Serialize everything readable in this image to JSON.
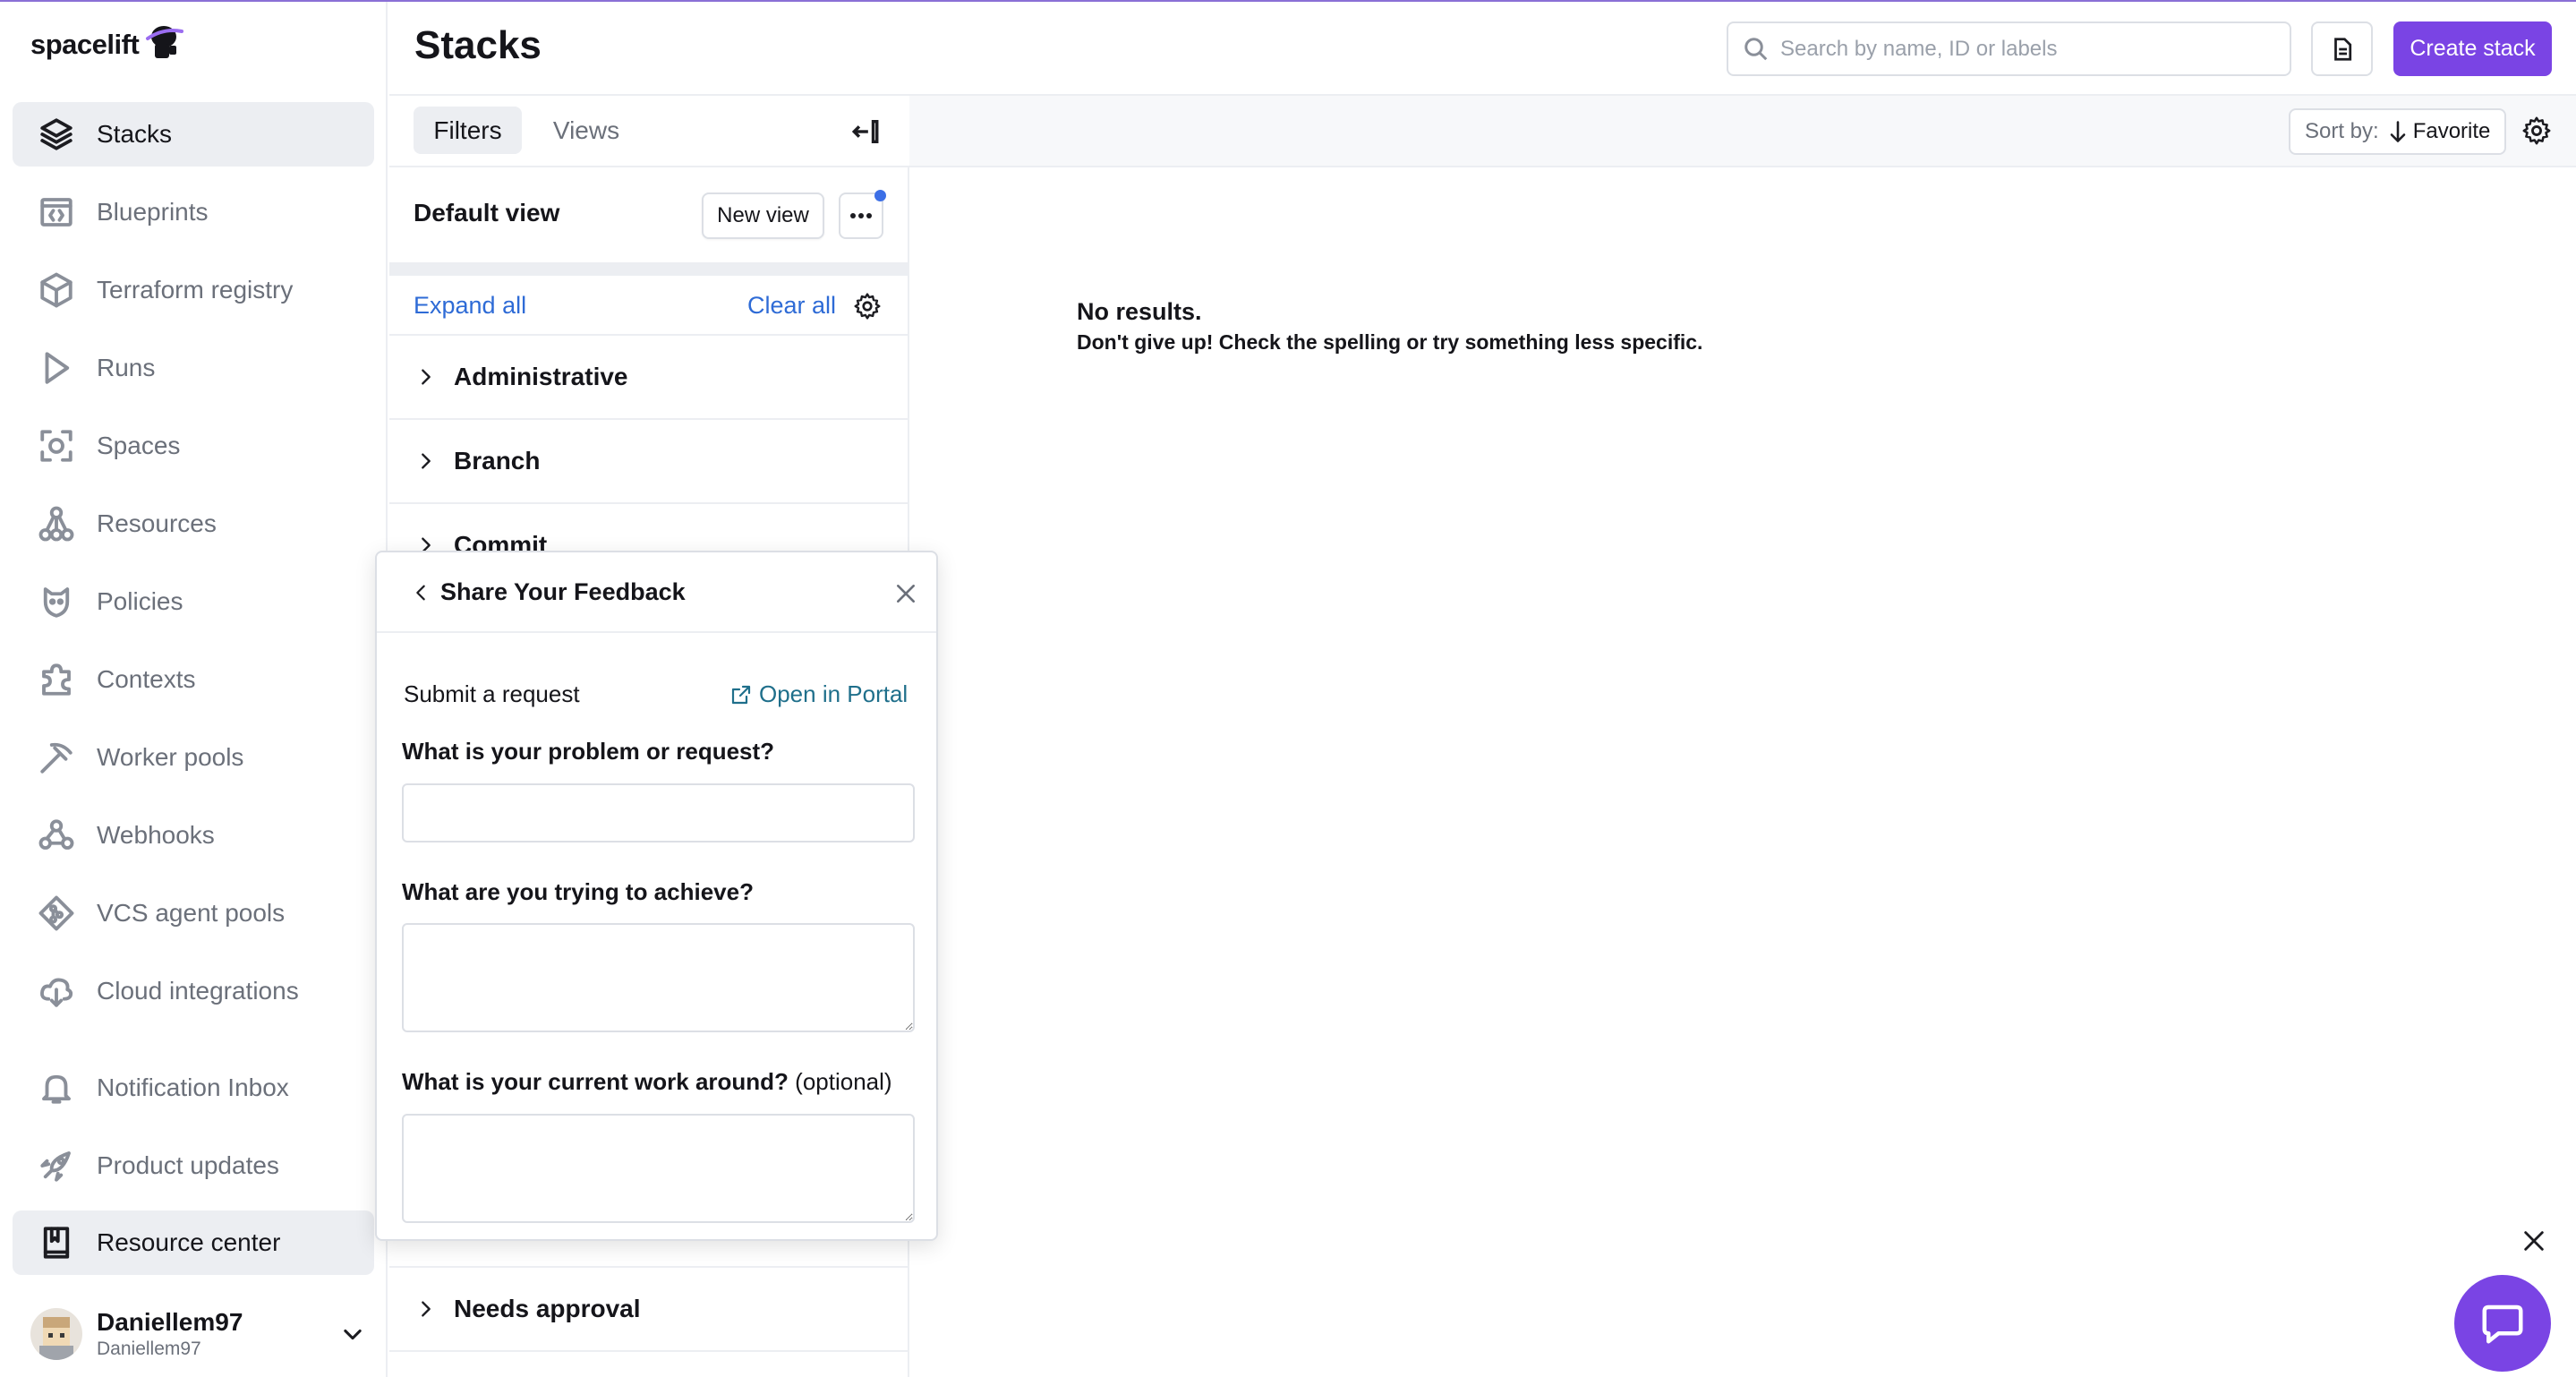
{
  "app": {
    "logo_text": "spacelift"
  },
  "sidebar": {
    "items": [
      {
        "label": "Stacks",
        "icon": "layers-icon",
        "active": true
      },
      {
        "label": "Blueprints",
        "icon": "code-window-icon"
      },
      {
        "label": "Terraform registry",
        "icon": "cube-icon"
      },
      {
        "label": "Runs",
        "icon": "play-icon"
      },
      {
        "label": "Spaces",
        "icon": "spaces-icon"
      },
      {
        "label": "Resources",
        "icon": "resources-icon"
      },
      {
        "label": "Policies",
        "icon": "policies-icon"
      },
      {
        "label": "Contexts",
        "icon": "puzzle-icon"
      },
      {
        "label": "Worker pools",
        "icon": "pickaxe-icon"
      },
      {
        "label": "Webhooks",
        "icon": "webhook-icon"
      },
      {
        "label": "VCS agent pools",
        "icon": "git-icon"
      },
      {
        "label": "Cloud integrations",
        "icon": "cloud-icon"
      },
      {
        "label": "Notification Inbox",
        "icon": "bell-icon"
      },
      {
        "label": "Product updates",
        "icon": "rocket-icon"
      },
      {
        "label": "Resource center",
        "icon": "book-icon",
        "highlighted": true
      }
    ],
    "user": {
      "name": "Daniellem97",
      "handle": "Daniellem97"
    }
  },
  "header": {
    "title": "Stacks",
    "search_placeholder": "Search by name, ID or labels",
    "create_label": "Create stack"
  },
  "tabs": {
    "filters": "Filters",
    "views": "Views"
  },
  "sort": {
    "label": "Sort by:",
    "value": "Favorite"
  },
  "filters": {
    "default_view": "Default view",
    "new_view": "New view",
    "expand_all": "Expand all",
    "clear_all": "Clear all",
    "rows": [
      "Administrative",
      "Branch",
      "Commit",
      "Needs approval"
    ]
  },
  "results": {
    "empty_title": "No results.",
    "empty_sub": "Don't give up! Check the spelling or try something less specific."
  },
  "feedback": {
    "title": "Share Your Feedback",
    "submit_label": "Submit a request",
    "portal_link": "Open in Portal",
    "q1": "What is your problem or request?",
    "q2": "What are you trying to achieve?",
    "q3": "What is your current work around?",
    "q3_optional": "(optional)"
  },
  "colors": {
    "accent": "#7a44e4",
    "link": "#2e6bd6",
    "portal": "#1f6f8b",
    "badge": "#3c6fe6"
  }
}
